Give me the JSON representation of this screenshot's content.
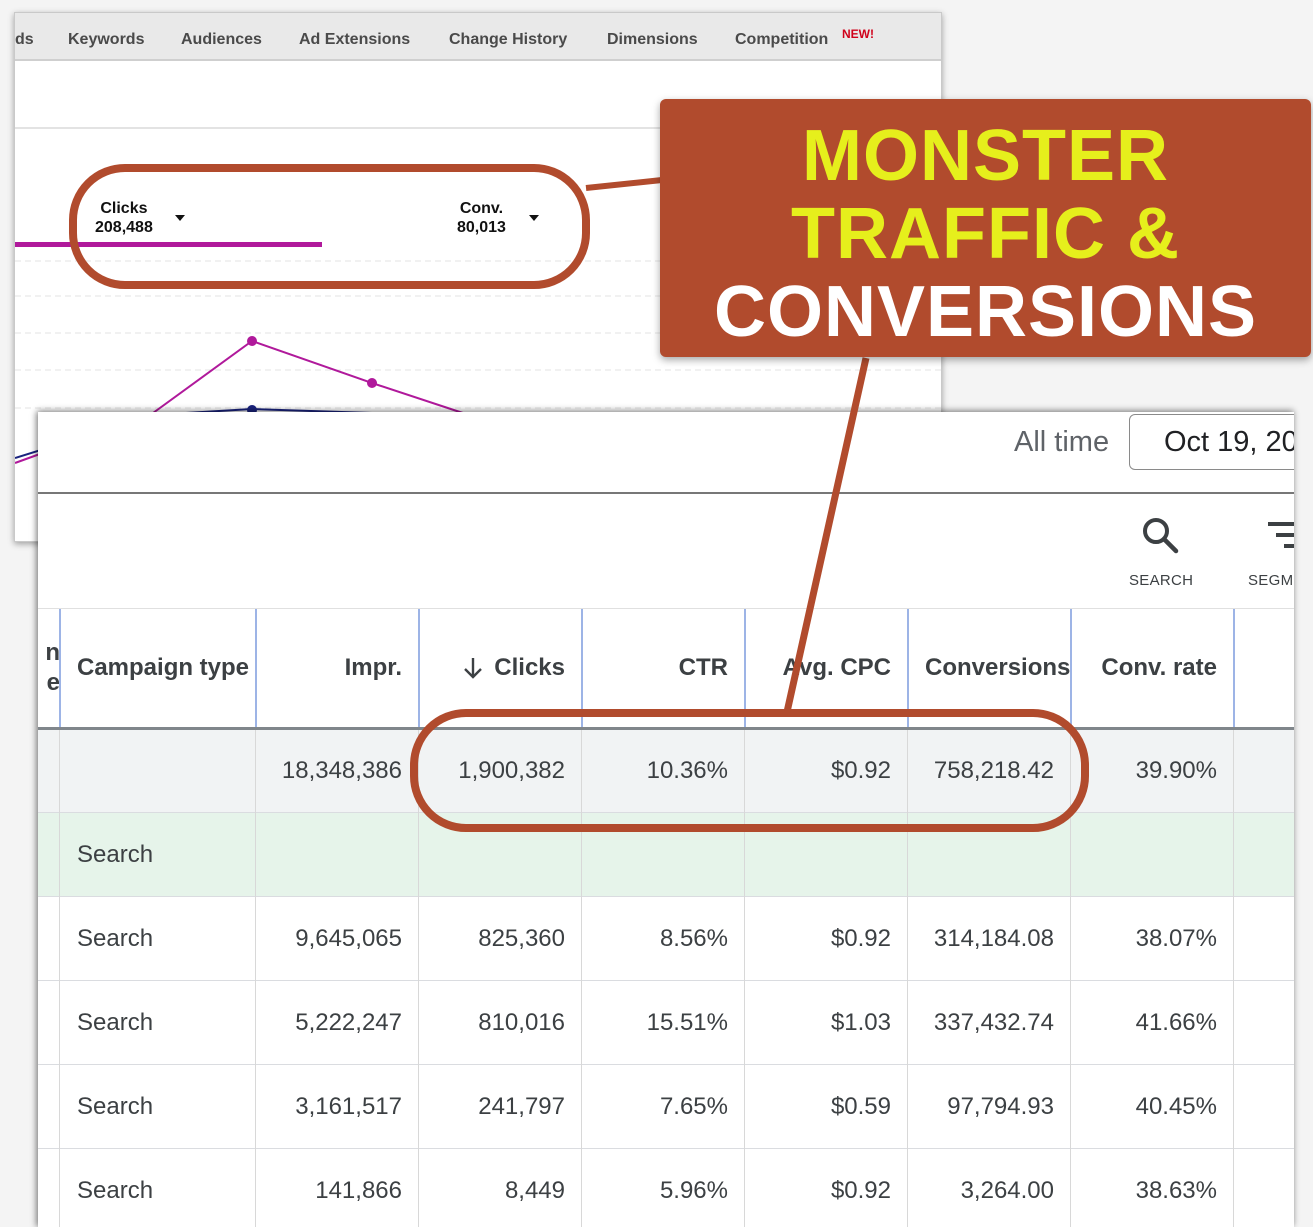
{
  "back_ui": {
    "tabs": [
      "ds",
      "Keywords",
      "Audiences",
      "Ad Extensions",
      "Change History",
      "Dimensions",
      "Competition"
    ],
    "new_badge": "NEW!",
    "metrics": {
      "clicks": {
        "label": "Clicks",
        "value": "208,488"
      },
      "conversions": {
        "label": "Conv.",
        "value": "80,013"
      }
    },
    "colors": {
      "clicks_series": "#b0199b",
      "conv_series": "#1a237e"
    }
  },
  "front_ui": {
    "date_range_label": "All time",
    "date_value": "Oct 19, 20",
    "toolbar": {
      "search_label": "SEARCH",
      "segment_label": "SEGM"
    },
    "table": {
      "headers": {
        "first_partial_top": "n",
        "first_partial_bottom": "e",
        "campaign_type": "Campaign type",
        "impr": "Impr.",
        "clicks": "Clicks",
        "ctr": "CTR",
        "avg_cpc": "Avg. CPC",
        "conversions": "Conversions",
        "conv_rate": "Conv. rate"
      },
      "total_row": {
        "campaign_type": "",
        "impr": "18,348,386",
        "clicks": "1,900,382",
        "ctr": "10.36%",
        "avg_cpc": "$0.92",
        "conversions": "758,218.42",
        "conv_rate": "39.90%"
      },
      "group_row": {
        "campaign_type": "Search"
      },
      "rows": [
        {
          "campaign_type": "Search",
          "impr": "9,645,065",
          "clicks": "825,360",
          "ctr": "8.56%",
          "avg_cpc": "$0.92",
          "conversions": "314,184.08",
          "conv_rate": "38.07%"
        },
        {
          "campaign_type": "Search",
          "impr": "5,222,247",
          "clicks": "810,016",
          "ctr": "15.51%",
          "avg_cpc": "$1.03",
          "conversions": "337,432.74",
          "conv_rate": "41.66%"
        },
        {
          "campaign_type": "Search",
          "impr": "3,161,517",
          "clicks": "241,797",
          "ctr": "7.65%",
          "avg_cpc": "$0.59",
          "conversions": "97,794.93",
          "conv_rate": "40.45%"
        },
        {
          "campaign_type": "Search",
          "impr": "141,866",
          "clicks": "8,449",
          "ctr": "5.96%",
          "avg_cpc": "$0.92",
          "conversions": "3,264.00",
          "conv_rate": "38.63%"
        }
      ]
    }
  },
  "callout": {
    "line1": "MONSTER",
    "line2": "TRAFFIC &",
    "line3": "CONVERSIONS",
    "colors": {
      "box": "#b14b2d",
      "highlight": "#e6ef1c",
      "text": "#ffffff"
    }
  }
}
